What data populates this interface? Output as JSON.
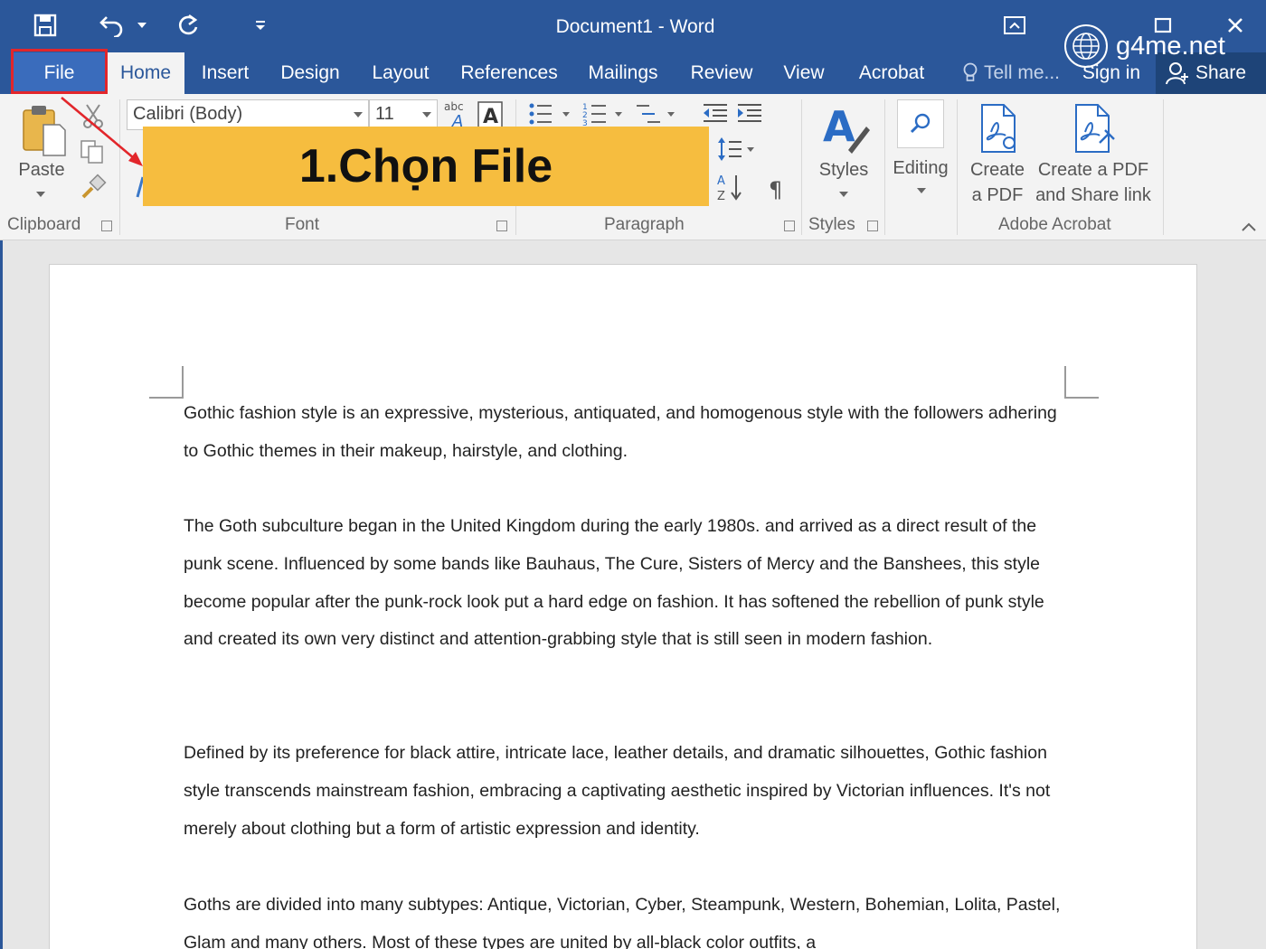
{
  "titlebar": {
    "title": "Document1 - Word"
  },
  "tabs": [
    {
      "label": "File"
    },
    {
      "label": "Home"
    },
    {
      "label": "Insert"
    },
    {
      "label": "Design"
    },
    {
      "label": "Layout"
    },
    {
      "label": "References"
    },
    {
      "label": "Mailings"
    },
    {
      "label": "Review"
    },
    {
      "label": "View"
    },
    {
      "label": "Acrobat"
    },
    {
      "label": "Tell me..."
    }
  ],
  "account": {
    "sign_in": "Sign in",
    "share": "Share"
  },
  "ribbon": {
    "clipboard": {
      "paste": "Paste",
      "group": "Clipboard"
    },
    "font": {
      "name": "Calibri (Body)",
      "size": "11",
      "group": "Font"
    },
    "paragraph": {
      "group": "Paragraph"
    },
    "styles": {
      "label": "Styles",
      "group": "Styles"
    },
    "editing": {
      "label": "Editing"
    },
    "acrobat": {
      "create_pdf_line1": "Create",
      "create_pdf_line2": "a PDF",
      "share_pdf_line1": "Create a PDF",
      "share_pdf_line2": "and Share link",
      "group": "Adobe Acrobat"
    }
  },
  "document": {
    "paragraphs": [
      "Gothic fashion style is an expressive, mysterious, antiquated, and homogenous style with the followers adhering to Gothic themes in their makeup, hairstyle, and clothing.",
      "The Goth subculture began in the United Kingdom during the early 1980s. and arrived as a direct result of the punk scene. Influenced by some bands like Bauhaus, The Cure, Sisters of Mercy and the Banshees, this style become popular after the punk-rock look put a hard edge on fashion. It has softened the rebellion of punk style and created its own very distinct and attention-grabbing style that is still seen in modern fashion.",
      "Defined by its preference for black attire, intricate lace, leather details, and dramatic silhouettes, Gothic fashion style transcends mainstream fashion, embracing a captivating aesthetic inspired by Victorian influences. It's not merely about clothing but a form of artistic expression and identity.",
      "Goths are divided into many subtypes: Antique, Victorian, Cyber, Steampunk, Western, Bohemian, Lolita, Pastel, Glam and many others. Most of these types are united by all-black color outfits, a"
    ]
  },
  "annotation": {
    "callout": "1.Chọn File",
    "watermark": "g4me.net"
  },
  "colors": {
    "word_blue": "#2b579a",
    "callout_yellow": "#f6bd3f",
    "highlight_red": "#e2262b"
  }
}
